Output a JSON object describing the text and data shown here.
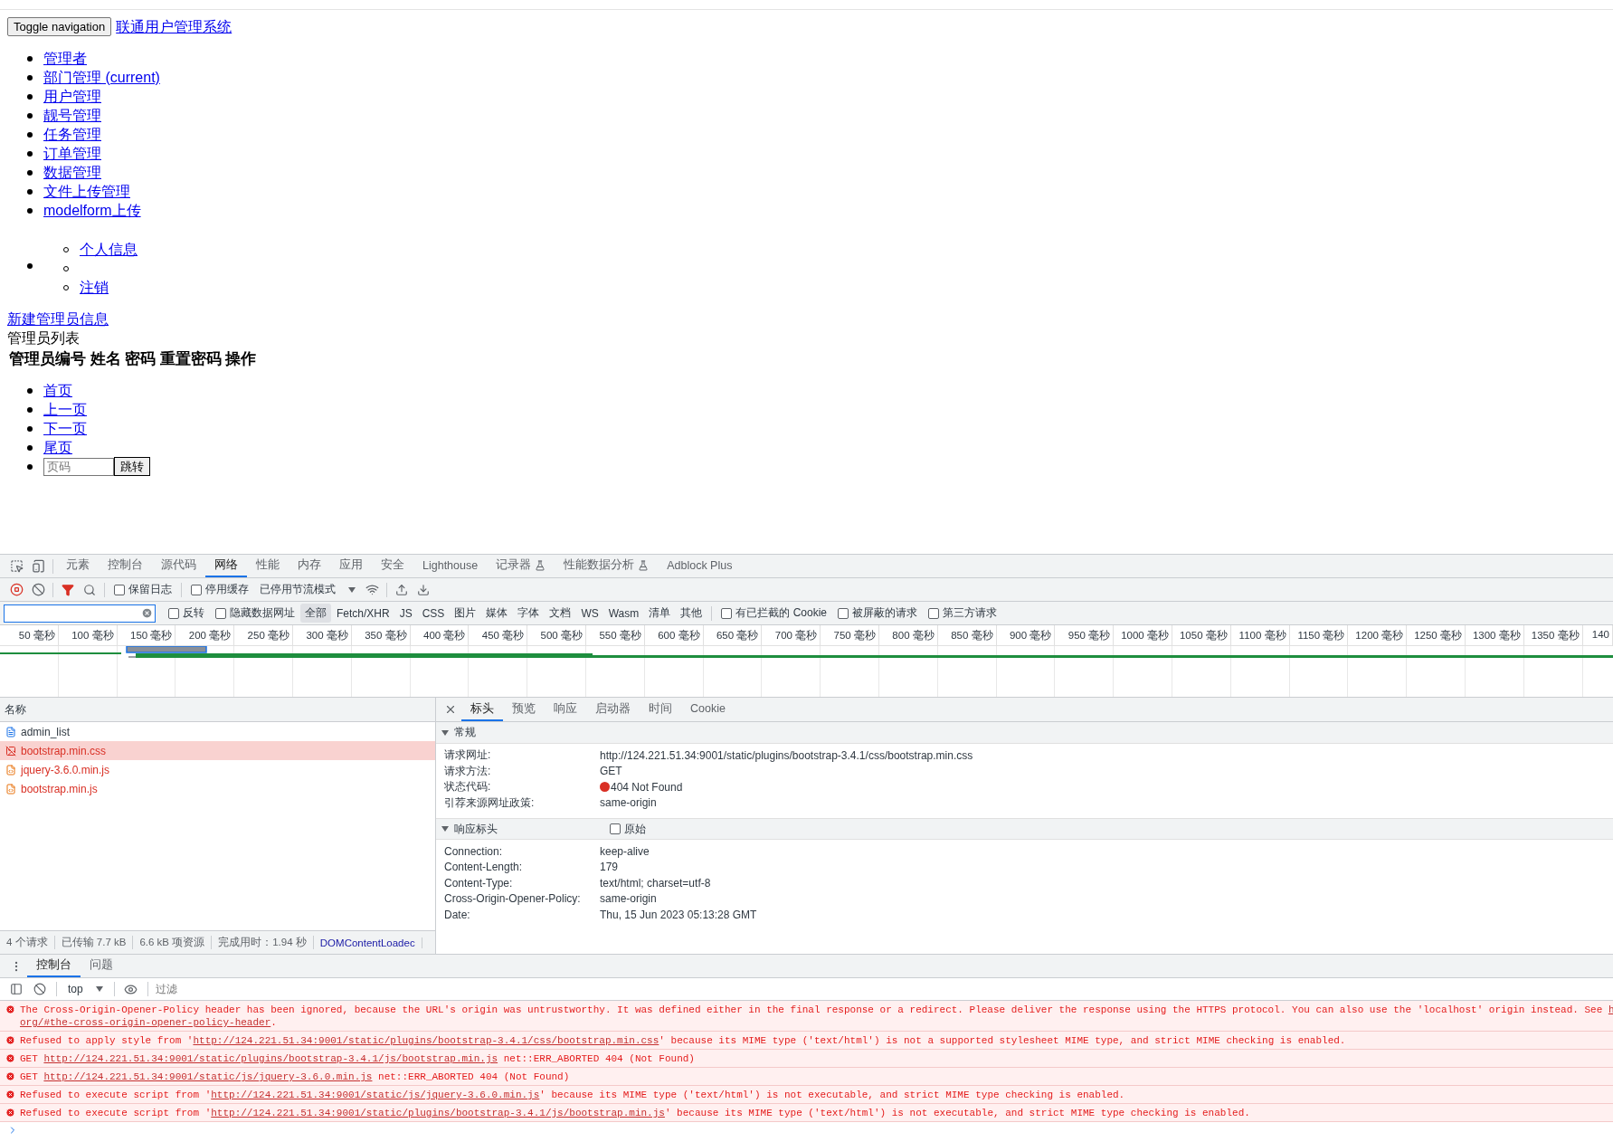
{
  "page": {
    "toggle_button": "Toggle navigation",
    "brand": "联通用户管理系统",
    "nav": [
      "管理者",
      "部门管理 (current)",
      "用户管理",
      "靓号管理",
      "任务管理",
      "订单管理",
      "数据管理",
      "文件上传管理",
      "modelform上传"
    ],
    "user_menu": [
      {
        "kind": "link",
        "label": "个人信息"
      },
      {
        "kind": "divider"
      },
      {
        "kind": "link",
        "label": "注销"
      }
    ],
    "new_link": "新建管理员信息",
    "panel_title": "管理员列表",
    "table_columns": [
      "管理员编号",
      "姓名",
      "密码",
      "重置密码",
      "操作"
    ],
    "pagination": [
      "首页",
      "上一页",
      "下一页",
      "尾页"
    ],
    "page_input": {
      "placeholder": "页码"
    },
    "jump_button": "跳转"
  },
  "devtools": {
    "tabs": [
      {
        "label": "元素",
        "selected": false,
        "experimental": false
      },
      {
        "label": "控制台",
        "selected": false,
        "experimental": false
      },
      {
        "label": "源代码",
        "selected": false,
        "experimental": false
      },
      {
        "label": "网络",
        "selected": true,
        "experimental": false
      },
      {
        "label": "性能",
        "selected": false,
        "experimental": false
      },
      {
        "label": "内存",
        "selected": false,
        "experimental": false
      },
      {
        "label": "应用",
        "selected": false,
        "experimental": false
      },
      {
        "label": "安全",
        "selected": false,
        "experimental": false
      },
      {
        "label": "Lighthouse",
        "selected": false,
        "experimental": false
      },
      {
        "label": "记录器",
        "selected": false,
        "experimental": true
      },
      {
        "label": "性能数据分析",
        "selected": false,
        "experimental": true
      },
      {
        "label": "Adblock Plus",
        "selected": false,
        "experimental": false
      }
    ],
    "toolbar": {
      "preserve_log": {
        "label": "保留日志",
        "checked": false
      },
      "disable_cache": {
        "label": "停用缓存",
        "checked": false
      },
      "throttling": "已停用节流模式"
    },
    "filter": {
      "invert": {
        "label": "反转",
        "checked": false
      },
      "hide_data_urls": {
        "label": "隐藏数据网址",
        "checked": false
      },
      "types": [
        {
          "label": "全部",
          "selected": true
        },
        {
          "label": "Fetch/XHR",
          "selected": false
        },
        {
          "label": "JS",
          "selected": false
        },
        {
          "label": "CSS",
          "selected": false
        },
        {
          "label": "图片",
          "selected": false
        },
        {
          "label": "媒体",
          "selected": false
        },
        {
          "label": "字体",
          "selected": false
        },
        {
          "label": "文档",
          "selected": false
        },
        {
          "label": "WS",
          "selected": false
        },
        {
          "label": "Wasm",
          "selected": false
        },
        {
          "label": "清单",
          "selected": false
        },
        {
          "label": "其他",
          "selected": false
        }
      ],
      "options": [
        {
          "label": "有已拦截的 Cookie",
          "checked": false
        },
        {
          "label": "被屏蔽的请求",
          "checked": false
        },
        {
          "label": "第三方请求",
          "checked": false
        }
      ]
    },
    "timeline_ticks": [
      "50 毫秒",
      "100 毫秒",
      "150 毫秒",
      "200 毫秒",
      "250 毫秒",
      "300 毫秒",
      "350 毫秒",
      "400 毫秒",
      "450 毫秒",
      "500 毫秒",
      "550 毫秒",
      "600 毫秒",
      "650 毫秒",
      "700 毫秒",
      "750 毫秒",
      "800 毫秒",
      "850 毫秒",
      "900 毫秒",
      "950 毫秒",
      "1000 毫秒",
      "1050 毫秒",
      "1100 毫秒",
      "1150 毫秒",
      "1200 毫秒",
      "1250 毫秒",
      "1300 毫秒",
      "1350 毫秒",
      "140"
    ],
    "requests_header": "名称",
    "requests": [
      {
        "name": "admin_list",
        "kind": "document",
        "failed": false,
        "selected": false
      },
      {
        "name": "bootstrap.min.css",
        "kind": "stylesheet",
        "failed": true,
        "selected": true
      },
      {
        "name": "jquery-3.6.0.min.js",
        "kind": "script",
        "failed": true,
        "selected": false
      },
      {
        "name": "bootstrap.min.js",
        "kind": "script",
        "failed": true,
        "selected": false
      }
    ],
    "summary": [
      "4 个请求",
      "已传输 7.7 kB",
      "6.6 kB 项资源",
      "完成用时：1.94 秒",
      "DOMContentLoadec"
    ],
    "detail_tabs": [
      {
        "label": "标头",
        "selected": true
      },
      {
        "label": "预览",
        "selected": false
      },
      {
        "label": "响应",
        "selected": false
      },
      {
        "label": "启动器",
        "selected": false
      },
      {
        "label": "时间",
        "selected": false
      },
      {
        "label": "Cookie",
        "selected": false
      }
    ],
    "general": {
      "title": "常规",
      "expanded": true,
      "rows": [
        {
          "name": "请求网址:",
          "value": "http://124.221.51.34:9001/static/plugins/bootstrap-3.4.1/css/bootstrap.min.css"
        },
        {
          "name": "请求方法:",
          "value": "GET"
        },
        {
          "name": "状态代码:",
          "value": "404 Not Found",
          "error": true
        },
        {
          "name": "引荐来源网址政策:",
          "value": "same-origin"
        }
      ]
    },
    "response_headers": {
      "title": "响应标头",
      "expanded": true,
      "raw": {
        "label": "原始",
        "checked": false
      },
      "rows": [
        {
          "name": "Connection:",
          "value": "keep-alive"
        },
        {
          "name": "Content-Length:",
          "value": "179"
        },
        {
          "name": "Content-Type:",
          "value": "text/html; charset=utf-8"
        },
        {
          "name": "Cross-Origin-Opener-Policy:",
          "value": "same-origin"
        },
        {
          "name": "Date:",
          "value": "Thu, 15 Jun 2023 05:13:28 GMT"
        }
      ]
    },
    "drawer_tabs": [
      {
        "label": "控制台",
        "selected": true
      },
      {
        "label": "问题",
        "selected": false
      }
    ],
    "console_context": "top",
    "console_filter": {
      "placeholder": "过滤"
    },
    "messages": [
      {
        "error": true,
        "parts": [
          {
            "kind": "text",
            "text": "The Cross-Origin-Opener-Policy header has been ignored, because the URL's origin was untrustworthy. It was defined either in the final response or a redirect. Please deliver the response using the HTTPS protocol. You can also use the 'localhost' origin instead. See "
          },
          {
            "kind": "link",
            "text": "h"
          },
          {
            "kind": "break"
          },
          {
            "kind": "link",
            "text": "org/#the-cross-origin-opener-policy-header"
          },
          {
            "kind": "text",
            "text": "."
          }
        ]
      },
      {
        "error": true,
        "parts": [
          {
            "kind": "text",
            "text": "Refused to apply style from '"
          },
          {
            "kind": "link",
            "text": "http://124.221.51.34:9001/static/plugins/bootstrap-3.4.1/css/bootstrap.min.css"
          },
          {
            "kind": "text",
            "text": "' because its MIME type ('text/html') is not a supported stylesheet MIME type, and strict MIME checking is enabled."
          }
        ]
      },
      {
        "error": true,
        "parts": [
          {
            "kind": "text",
            "text": "GET "
          },
          {
            "kind": "link",
            "text": "http://124.221.51.34:9001/static/plugins/bootstrap-3.4.1/js/bootstrap.min.js"
          },
          {
            "kind": "text",
            "text": " net::ERR_ABORTED 404 (Not Found)"
          }
        ]
      },
      {
        "error": true,
        "parts": [
          {
            "kind": "text",
            "text": "GET "
          },
          {
            "kind": "link",
            "text": "http://124.221.51.34:9001/static/js/jquery-3.6.0.min.js"
          },
          {
            "kind": "text",
            "text": " net::ERR_ABORTED 404 (Not Found)"
          }
        ]
      },
      {
        "error": true,
        "parts": [
          {
            "kind": "text",
            "text": "Refused to execute script from '"
          },
          {
            "kind": "link",
            "text": "http://124.221.51.34:9001/static/js/jquery-3.6.0.min.js"
          },
          {
            "kind": "text",
            "text": "' because its MIME type ('text/html') is not executable, and strict MIME type checking is enabled."
          }
        ]
      },
      {
        "error": true,
        "parts": [
          {
            "kind": "text",
            "text": "Refused to execute script from '"
          },
          {
            "kind": "link",
            "text": "http://124.221.51.34:9001/static/plugins/bootstrap-3.4.1/js/bootstrap.min.js"
          },
          {
            "kind": "text",
            "text": "' because its MIME type ('text/html') is not executable, and strict MIME type checking is enabled."
          }
        ]
      }
    ]
  }
}
